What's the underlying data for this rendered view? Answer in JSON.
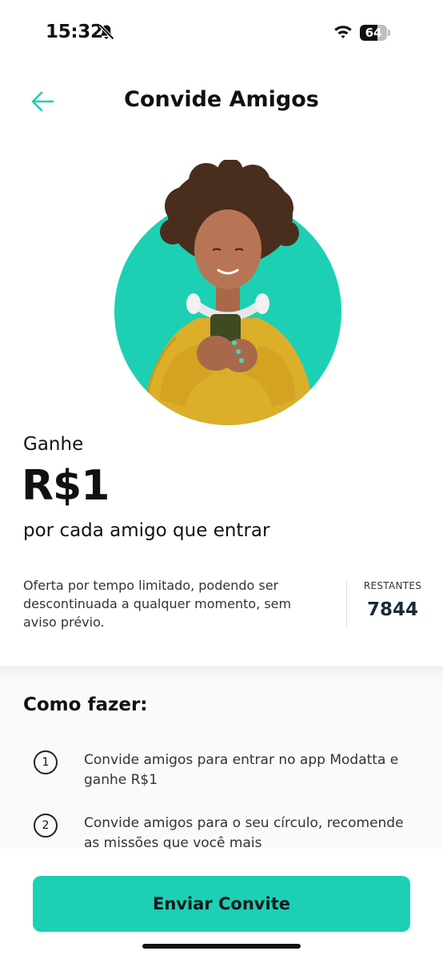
{
  "status_bar": {
    "time": "15:32",
    "battery_level": "64",
    "battery_fraction": 0.64,
    "icons": [
      "bell-slash-icon",
      "wifi-icon",
      "battery-icon"
    ]
  },
  "header": {
    "back_icon": "arrow-left-icon",
    "title": "Convide Amigos"
  },
  "hero": {
    "icon": "hero-illustration",
    "circle_color": "#1dd0b3"
  },
  "reward": {
    "lead": "Ganhe",
    "amount": "R$1",
    "subtitle": "por cada amigo que entrar"
  },
  "offer": {
    "note": "Oferta por tempo limitado, podendo ser descontinuada a qualquer momento, sem aviso prévio.",
    "remaining_label": "RESTANTES",
    "remaining_value": "7844"
  },
  "how_to": {
    "title": "Como fazer:",
    "steps": [
      {
        "number": "1",
        "text": "Convide amigos para entrar no app Modatta e ganhe R$1"
      },
      {
        "number": "2",
        "text": "Convide amigos para o seu círculo, recomende as missões que você mais"
      }
    ]
  },
  "cta": {
    "label": "Enviar Convite"
  },
  "colors": {
    "accent": "#1dd0b3",
    "text": "#111111",
    "counter": "#1b2a3a"
  }
}
